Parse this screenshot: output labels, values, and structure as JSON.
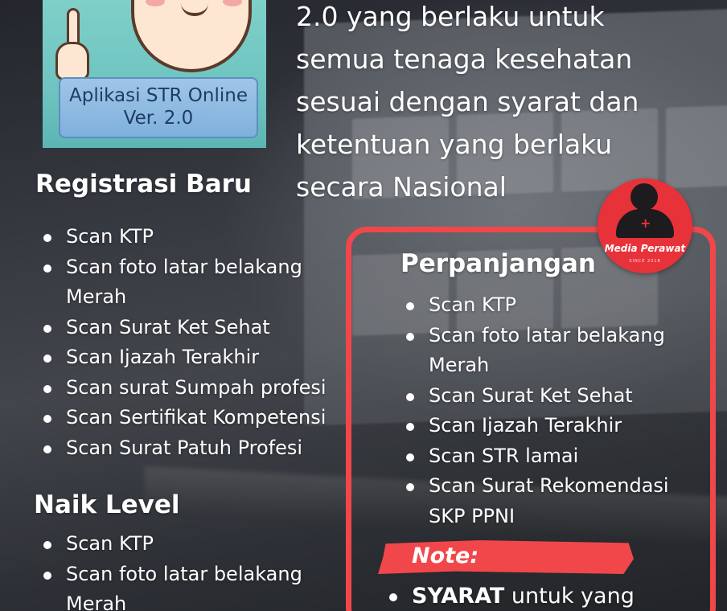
{
  "logo": {
    "line1": "Aplikasi STR Online",
    "line2": "Ver. 2.0"
  },
  "top_paragraph": [
    "2.0 yang berlaku untuk",
    "semua tenaga kesehatan",
    "sesuai dengan syarat dan",
    "ketentuan yang berlaku",
    "secara Nasional"
  ],
  "registrasi_baru": {
    "heading": "Registrasi Baru",
    "items": [
      "Scan KTP",
      "Scan foto latar belakang Merah",
      "Scan Surat Ket Sehat",
      "Scan Ijazah Terakhir",
      "Scan surat Sumpah profesi",
      "Scan Sertifikat Kompetensi",
      "Scan Surat Patuh Profesi"
    ]
  },
  "naik_level": {
    "heading": "Naik Level",
    "items": [
      "Scan KTP",
      "Scan foto latar belakang Merah"
    ]
  },
  "perpanjangan": {
    "heading": "Perpanjangan",
    "items": [
      "Scan KTP",
      "Scan foto latar belakang Merah",
      "Scan Surat Ket Sehat",
      "Scan Ijazah Terakhir",
      "Scan STR lamai",
      "Scan Surat Rekomendasi SKP PPNI"
    ]
  },
  "media_badge": {
    "name": "Media Perawat",
    "since": "SINCE 2018"
  },
  "note": {
    "label": "Note:",
    "first_item_bold": "SYARAT",
    "first_item_rest": " untuk yang"
  },
  "colors": {
    "accent_red": "#f2474a",
    "text": "#ffffff"
  }
}
